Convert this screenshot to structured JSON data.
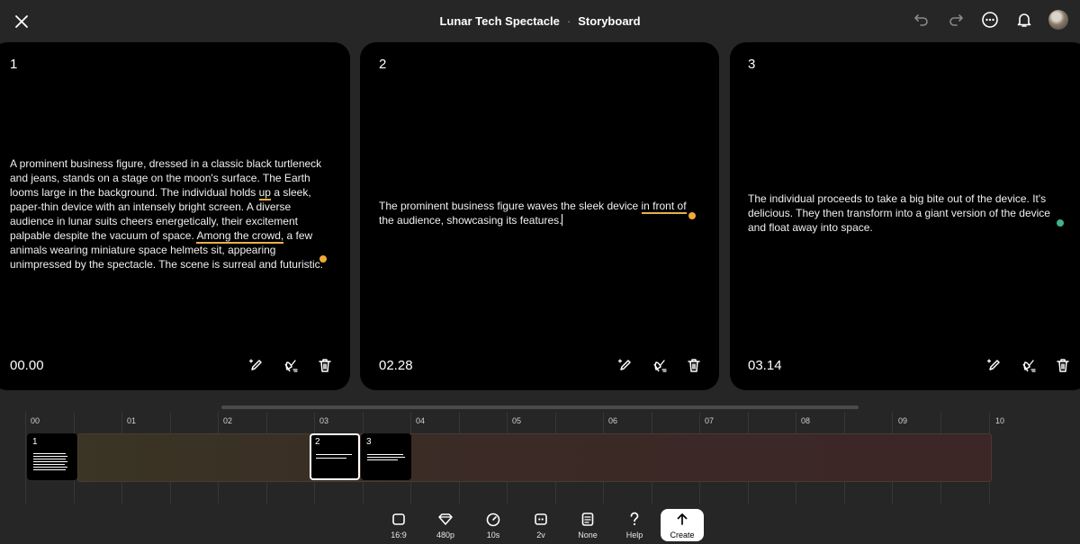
{
  "header": {
    "project": "Lunar Tech Spectacle",
    "separator": "·",
    "view": "Storyboard"
  },
  "icons": {
    "close": "close-icon",
    "undo": "undo-icon",
    "redo": "redo-icon",
    "more": "more-icon",
    "notifications": "bell-icon",
    "avatar": "avatar"
  },
  "colors": {
    "highlight": "#e8b04b",
    "marker_orange": "#f2a93b",
    "marker_green": "#3fb28a"
  },
  "scenes": [
    {
      "number": "1",
      "text_before": "A prominent business figure, dressed in a classic black turtleneck and jeans, stands on a stage on the moon's surface. The Earth looms large in the background. The individual holds ",
      "highlight1": "up",
      "text_middle": " a sleek, paper-thin device with an intensely bright screen. A diverse audience in lunar suits cheers energetically, their excitement palpable despite the vacuum of space. ",
      "highlight2": "Among the crowd,",
      "text_after": " a few animals wearing miniature space helmets sit, appearing unimpressed by the spectacle. The scene is surreal and futuristic.",
      "time": "00.00"
    },
    {
      "number": "2",
      "text_before": "The prominent business figure waves the sleek device ",
      "highlight1": "in front of",
      "text_after": " the audience, showcasing its features.",
      "time": "02.28"
    },
    {
      "number": "3",
      "text": "The individual proceeds to take a big bite out of the device. It's delicious. They then transform into a giant version of the device and float away into space.",
      "time": "03.14"
    }
  ],
  "timeline": {
    "ticks": [
      "00",
      "01",
      "02",
      "03",
      "04",
      "05",
      "06",
      "07",
      "08",
      "09",
      "10"
    ],
    "clips": [
      "1",
      "2",
      "3"
    ]
  },
  "toolbar": {
    "aspect": "16:9",
    "resolution": "480p",
    "duration": "10s",
    "variants": "2v",
    "style": "None",
    "help": "Help",
    "create": "Create"
  }
}
